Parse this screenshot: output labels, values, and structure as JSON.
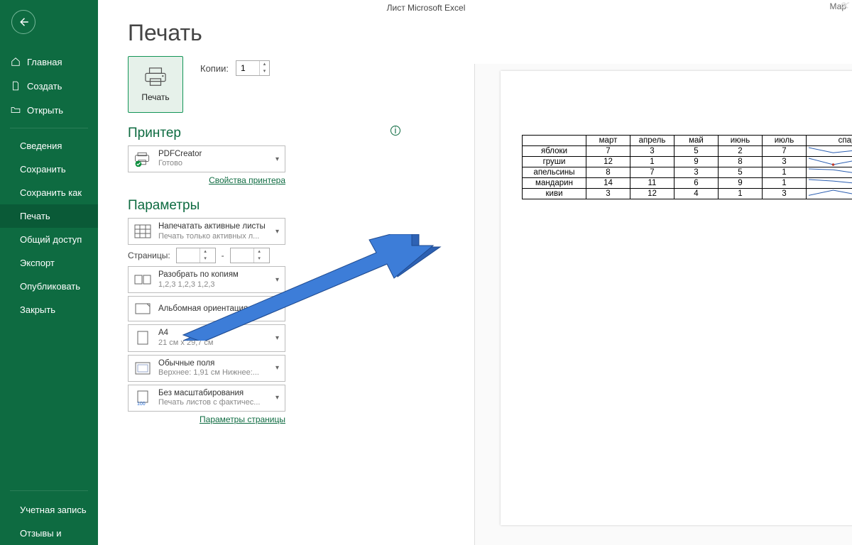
{
  "titlebar": {
    "title": "Лист Microsoft Excel",
    "user": "Мар"
  },
  "sidebar": {
    "items": [
      {
        "label": "Главная"
      },
      {
        "label": "Создать"
      },
      {
        "label": "Открыть"
      },
      {
        "label": "Сведения"
      },
      {
        "label": "Сохранить"
      },
      {
        "label": "Сохранить как"
      },
      {
        "label": "Печать"
      },
      {
        "label": "Общий доступ"
      },
      {
        "label": "Экспорт"
      },
      {
        "label": "Опубликовать"
      },
      {
        "label": "Закрыть"
      }
    ],
    "bottom": [
      {
        "label": "Учетная запись"
      },
      {
        "label": "Отзывы и"
      }
    ]
  },
  "page": {
    "title": "Печать"
  },
  "print_btn": {
    "label": "Печать"
  },
  "copies": {
    "label": "Копии:",
    "value": "1"
  },
  "printer": {
    "section": "Принтер",
    "name": "PDFCreator",
    "status": "Готово",
    "props_link": "Свойства принтера"
  },
  "settings": {
    "section": "Параметры",
    "active_sheets": {
      "title": "Напечатать активные листы",
      "sub": "Печать только активных л..."
    },
    "pages_label": "Страницы:",
    "pages_sep": "-",
    "collate": {
      "title": "Разобрать по копиям",
      "sub": "1,2,3    1,2,3    1,2,3"
    },
    "orientation": {
      "title": "Альбомная ориентация"
    },
    "paper": {
      "title": "A4",
      "sub": "21 см x 29,7 см"
    },
    "margins": {
      "title": "Обычные поля",
      "sub": "Верхнее: 1,91 см Нижнее:..."
    },
    "scaling": {
      "title": "Без масштабирования",
      "sub": "Печать листов с фактичес..."
    },
    "page_setup_link": "Параметры страницы"
  },
  "table": {
    "headers": [
      "",
      "март",
      "апрель",
      "май",
      "июнь",
      "июль",
      "спарклайн"
    ],
    "rows": [
      {
        "name": "яблоки",
        "vals": [
          7,
          3,
          5,
          2,
          7
        ]
      },
      {
        "name": "груши",
        "vals": [
          12,
          1,
          9,
          8,
          3
        ]
      },
      {
        "name": "апельсины",
        "vals": [
          8,
          7,
          3,
          5,
          1
        ]
      },
      {
        "name": "мандарин",
        "vals": [
          14,
          11,
          6,
          9,
          1
        ]
      },
      {
        "name": "киви",
        "vals": [
          3,
          12,
          4,
          1,
          3
        ]
      }
    ]
  }
}
